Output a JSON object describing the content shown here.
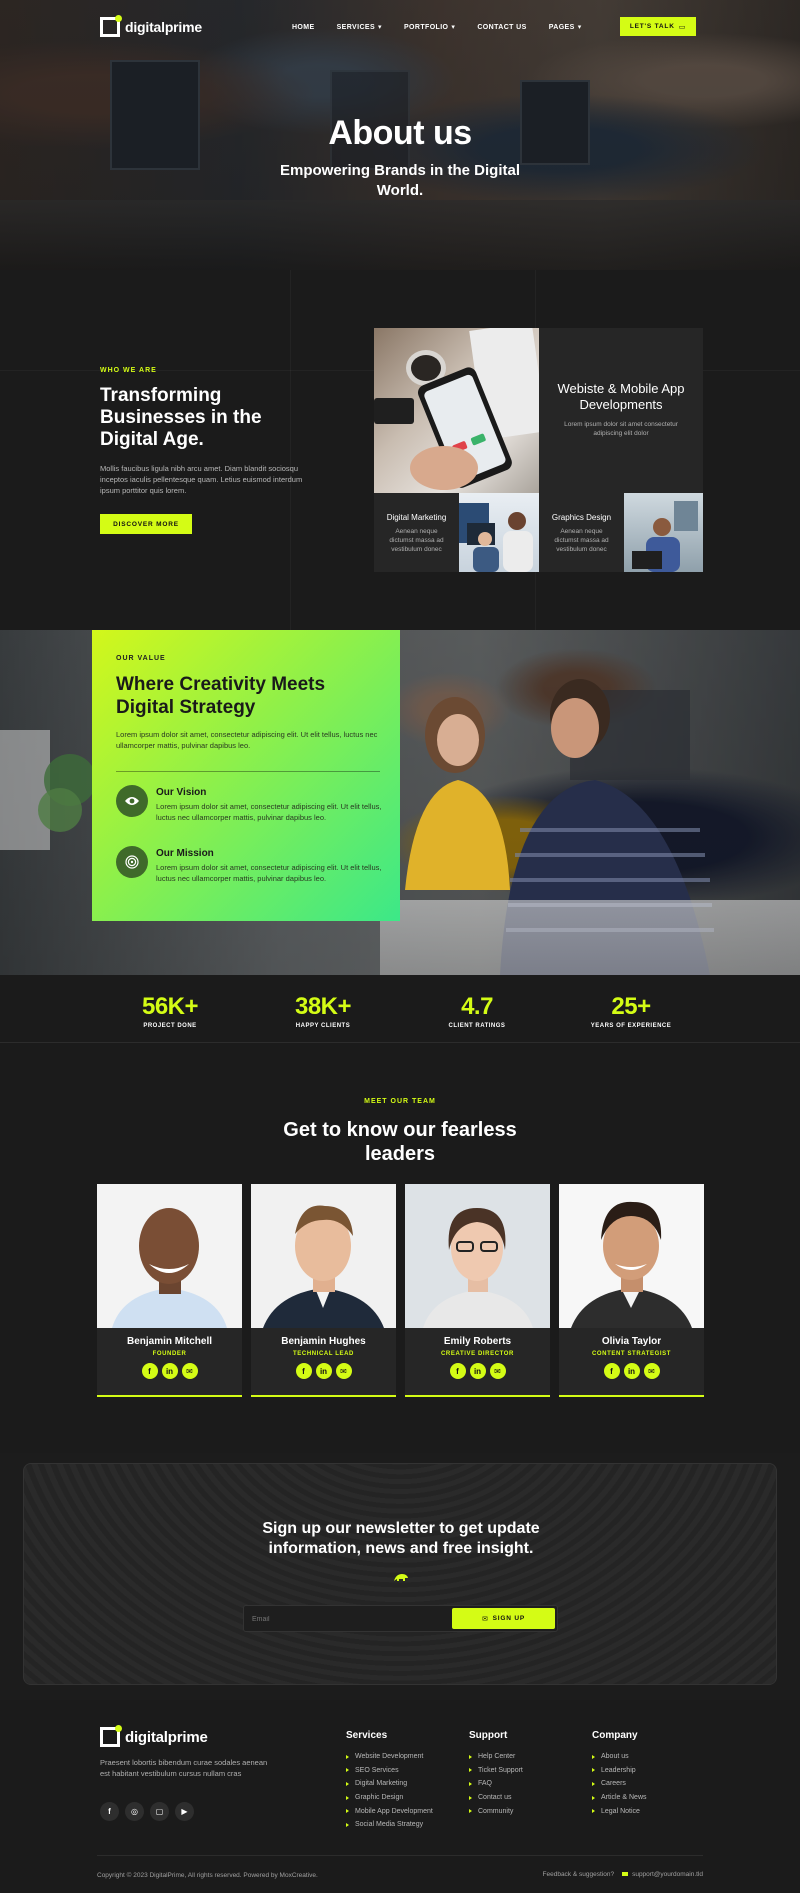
{
  "brand": {
    "name": "digitalprime"
  },
  "nav": {
    "items": [
      {
        "label": "HOME"
      },
      {
        "label": "SERVICES"
      },
      {
        "label": "PORTFOLIO"
      },
      {
        "label": "CONTACT US"
      },
      {
        "label": "PAGES"
      }
    ],
    "cta": "LET'S TALK"
  },
  "hero": {
    "title": "About us",
    "subtitle": "Empowering Brands in the Digital World."
  },
  "who": {
    "eyebrow": "WHO WE ARE",
    "title": "Transforming Businesses in the Digital Age.",
    "body": "Mollis faucibus ligula nibh arcu amet. Diam blandit sociosqu inceptos iaculis pellentesque quam. Letius euismod interdum ipsum porttitor quis lorem.",
    "button": "DISCOVER MORE",
    "feature_title": "Webiste & Mobile App Developments",
    "feature_text": "Lorem ipsum dolor sit amet consectetur adipiscing elit dolor",
    "service1_title": "Digital Marketing",
    "service1_text": "Aenean neque dictumst massa ad vestibulum donec",
    "service2_title": "Graphics Design",
    "service2_text": "Aenean neque dictumst massa ad vestibulum donec"
  },
  "value": {
    "eyebrow": "OUR VALUE",
    "title": "Where Creativity Meets Digital Strategy",
    "lead": "Lorem ipsum dolor sit amet, consectetur adipiscing elit. Ut elit tellus, luctus nec ullamcorper mattis, pulvinar dapibus leo.",
    "vision_title": "Our Vision",
    "vision_text": "Lorem ipsum dolor sit amet, consectetur adipiscing elit. Ut elit tellus, luctus nec ullamcorper mattis, pulvinar dapibus leo.",
    "mission_title": "Our Mission",
    "mission_text": "Lorem ipsum dolor sit amet, consectetur adipiscing elit. Ut elit tellus, luctus nec ullamcorper mattis, pulvinar dapibus leo."
  },
  "stats": [
    {
      "value": "56K+",
      "label": "PROJECT DONE"
    },
    {
      "value": "38K+",
      "label": "HAPPY CLIENTS"
    },
    {
      "value": "4.7",
      "label": "CLIENT RATINGS"
    },
    {
      "value": "25+",
      "label": "YEARS OF EXPERIENCE"
    }
  ],
  "team": {
    "eyebrow": "MEET OUR TEAM",
    "title": "Get to know our fearless leaders",
    "members": [
      {
        "name": "Benjamin Mitchell",
        "role": "FOUNDER"
      },
      {
        "name": "Benjamin Hughes",
        "role": "TECHNICAL LEAD"
      },
      {
        "name": "Emily Roberts",
        "role": "CREATIVE DIRECTOR"
      },
      {
        "name": "Olivia Taylor",
        "role": "CONTENT STRATEGIST"
      }
    ],
    "social_icons": [
      "facebook-icon",
      "linkedin-icon",
      "mail-icon"
    ]
  },
  "newsletter": {
    "title": "Sign up our newsletter to get update information, news and free insight.",
    "placeholder": "Email",
    "button": "SIGN UP"
  },
  "footer": {
    "about": "Praesent lobortis bibendum curae sodales aenean est habitant vestibulum cursus nullam cras",
    "services_title": "Services",
    "services": [
      "Website Development",
      "SEO Services",
      "Digital Marketing",
      "Graphic Design",
      "Mobile App Development",
      "Social Media Strategy"
    ],
    "support_title": "Support",
    "support": [
      "Help Center",
      "Ticket Support",
      "FAQ",
      "Contact us",
      "Community"
    ],
    "company_title": "Company",
    "company": [
      "About us",
      "Leadership",
      "Careers",
      "Article & News",
      "Legal Notice"
    ],
    "copyright": "Copyright © 2023 DigitalPrime, All rights reserved. Powered by MoxCreative.",
    "feedback": "Feedback & suggestion?",
    "email": "support@yourdomain.tld"
  },
  "colors": {
    "accent": "#d4fc15",
    "background": "#1b1b1b",
    "card": "#262626"
  }
}
